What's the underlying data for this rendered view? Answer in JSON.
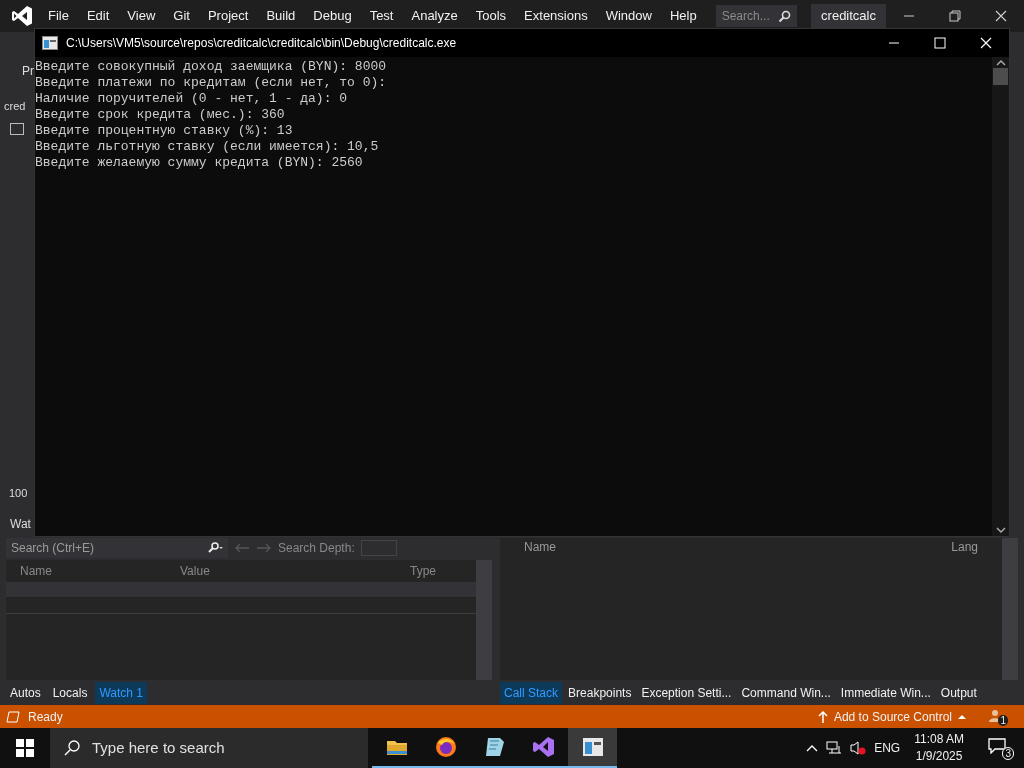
{
  "vs": {
    "menu": [
      "File",
      "Edit",
      "View",
      "Git",
      "Project",
      "Build",
      "Debug",
      "Test",
      "Analyze",
      "Tools",
      "Extensions",
      "Window",
      "Help"
    ],
    "search": {
      "placeholder": "Search..."
    },
    "solution_name": "creditcalc",
    "left_strip": [
      "Pr",
      "cred"
    ],
    "zoom_label": "100",
    "tool_tab": "Wat"
  },
  "console": {
    "title": "C:\\Users\\VM5\\source\\repos\\creditcalc\\creditcalc\\bin\\Debug\\creditcalc.exe",
    "lines": [
      "Введите совокупный доход заемщика (BYN): 8000",
      "Введите платежи по кредитам (если нет, то 0):",
      "Наличие поручителей (0 - нет, 1 - да): 0",
      "Введите срок кредита (мес.): 360",
      "Введите процентную ставку (%): 13",
      "Введите льготную ставку (если имеется): 10,5",
      "Введите желаемую сумму кредита (BYN): 2560"
    ]
  },
  "watch_panel": {
    "search": {
      "placeholder": "Search (Ctrl+E)"
    },
    "depth_label": "Search Depth:",
    "columns": [
      "Name",
      "Value",
      "Type"
    ],
    "tabs": [
      {
        "label": "Autos",
        "selected": false
      },
      {
        "label": "Locals",
        "selected": false
      },
      {
        "label": "Watch 1",
        "selected": true
      }
    ]
  },
  "callstack_panel": {
    "columns": [
      "Name",
      "Lang"
    ],
    "tabs": [
      {
        "label": "Call Stack",
        "selected": true
      },
      {
        "label": "Breakpoints",
        "selected": false
      },
      {
        "label": "Exception Setti...",
        "selected": false
      },
      {
        "label": "Command Win...",
        "selected": false
      },
      {
        "label": "Immediate Win...",
        "selected": false
      },
      {
        "label": "Output",
        "selected": false
      }
    ]
  },
  "status_bar": {
    "text": "Ready",
    "source_control": "Add to Source Control",
    "notifications": "1"
  },
  "taskbar": {
    "search": {
      "placeholder": "Type here to search"
    },
    "apps": [
      {
        "kind": "folder",
        "selected": false
      },
      {
        "kind": "browser",
        "selected": false
      },
      {
        "kind": "notepad",
        "selected": false
      },
      {
        "kind": "ide",
        "selected": false
      },
      {
        "kind": "console",
        "selected": true
      }
    ],
    "language": "ENG",
    "time": "11:08 AM",
    "date": "1/9/2025",
    "notifications": "3"
  }
}
